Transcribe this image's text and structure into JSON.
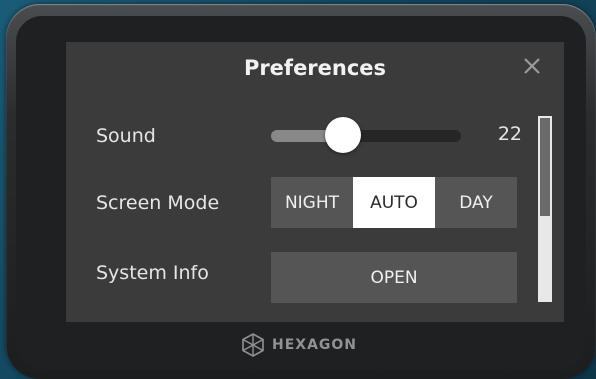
{
  "dialog": {
    "title": "Preferences",
    "close_icon": "close-icon"
  },
  "sound": {
    "label": "Sound",
    "value": "22",
    "level_percent": 38
  },
  "screen_mode": {
    "label": "Screen Mode",
    "options": [
      "NIGHT",
      "AUTO",
      "DAY"
    ],
    "selected": "AUTO"
  },
  "system_info": {
    "label": "System Info",
    "button_label": "OPEN"
  },
  "scrollbar": {
    "position_fraction": 0.0
  },
  "brand": {
    "name": "HEXAGON",
    "logo_icon": "hexagon-logo-icon"
  },
  "colors": {
    "screen_bg": "#3b3b3b",
    "control_bg": "#555555",
    "selected_bg": "#ffffff",
    "text": "#e6e6e6",
    "slider_fill": "#888888"
  }
}
